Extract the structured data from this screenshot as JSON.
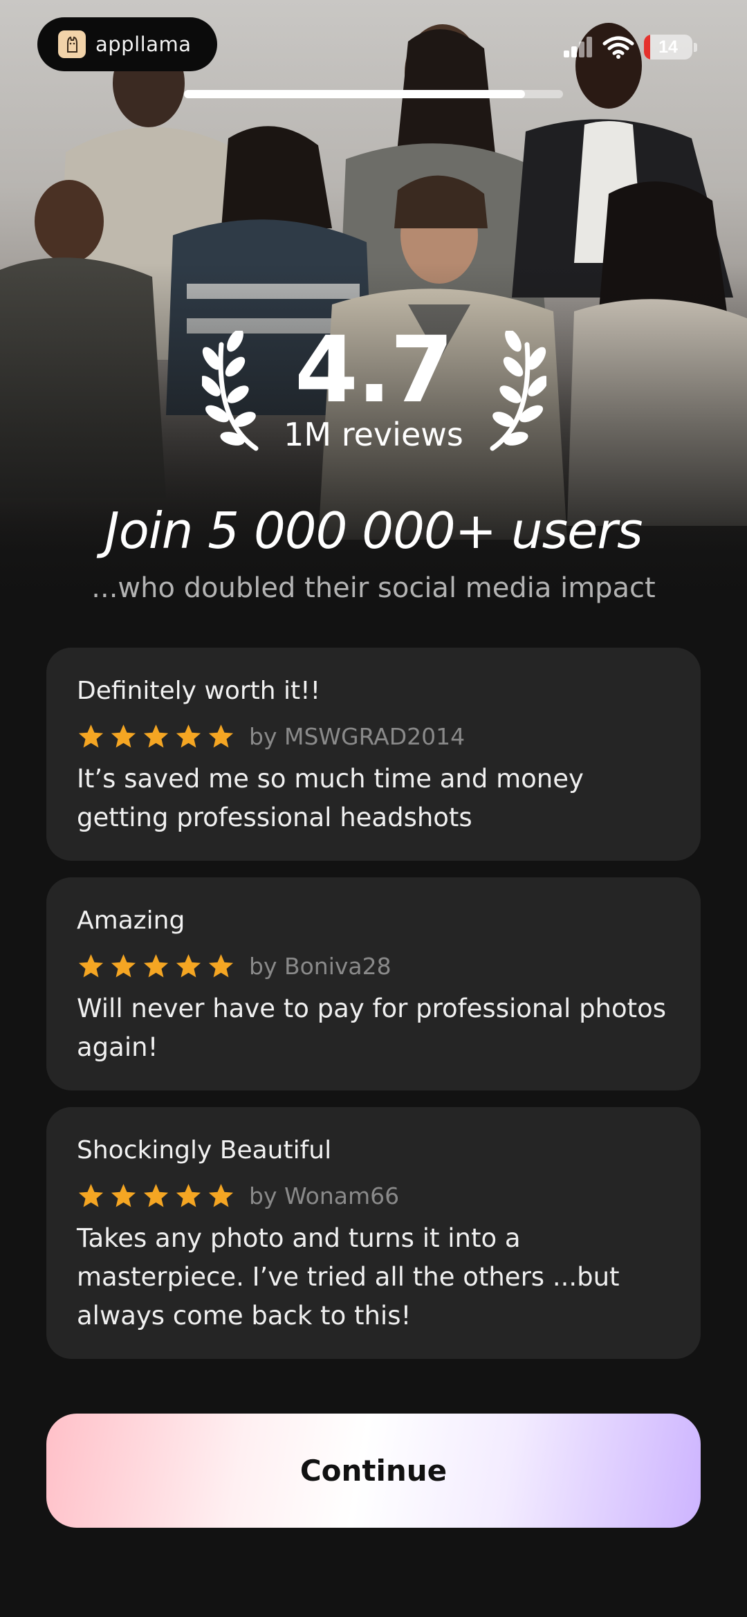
{
  "app": {
    "name": "appllama",
    "onboarding_progress": 0.9
  },
  "status_bar": {
    "battery": "14",
    "signal_icon": "signal-bars-icon",
    "wifi_icon": "wifi-icon"
  },
  "rating": {
    "score": "4.7",
    "reviews": "1M reviews"
  },
  "headline": {
    "title": "Join 5 000 000+ users",
    "subtitle": "...who doubled their social media impact"
  },
  "reviews": [
    {
      "title": "Definitely worth it!!",
      "stars": 5,
      "author": "by MSWGRAD2014",
      "body": "It’s saved me so much time and money getting professional headshots"
    },
    {
      "title": "Amazing",
      "stars": 5,
      "author": "by Boniva28",
      "body": "Will never have to pay for professional photos again!"
    },
    {
      "title": "Shockingly Beautiful",
      "stars": 5,
      "author": "by Wonam66",
      "body": "Takes any photo and turns it into a masterpiece. I’ve tried all the others ...but always come back to this!"
    }
  ],
  "cta": {
    "label": "Continue"
  },
  "colors": {
    "background": "#121212",
    "card": "#252525",
    "star": "#f5a623",
    "cta_gradient_start": "#ffc0c8",
    "cta_gradient_end": "#cdb4ff"
  }
}
